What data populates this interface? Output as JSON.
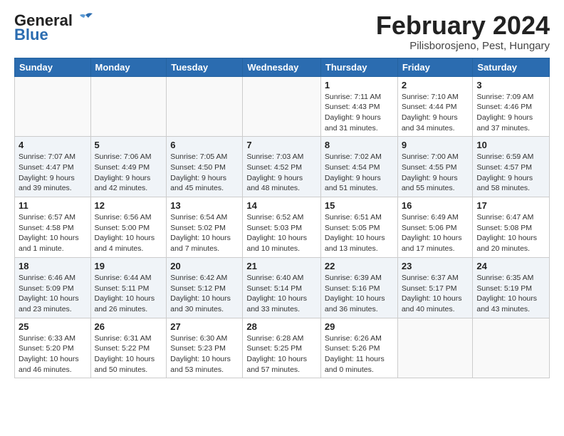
{
  "header": {
    "logo_general": "General",
    "logo_blue": "Blue",
    "month_title": "February 2024",
    "location": "Pilisborosjeno, Pest, Hungary"
  },
  "days_of_week": [
    "Sunday",
    "Monday",
    "Tuesday",
    "Wednesday",
    "Thursday",
    "Friday",
    "Saturday"
  ],
  "weeks": [
    [
      {
        "day": "",
        "info": ""
      },
      {
        "day": "",
        "info": ""
      },
      {
        "day": "",
        "info": ""
      },
      {
        "day": "",
        "info": ""
      },
      {
        "day": "1",
        "info": "Sunrise: 7:11 AM\nSunset: 4:43 PM\nDaylight: 9 hours\nand 31 minutes."
      },
      {
        "day": "2",
        "info": "Sunrise: 7:10 AM\nSunset: 4:44 PM\nDaylight: 9 hours\nand 34 minutes."
      },
      {
        "day": "3",
        "info": "Sunrise: 7:09 AM\nSunset: 4:46 PM\nDaylight: 9 hours\nand 37 minutes."
      }
    ],
    [
      {
        "day": "4",
        "info": "Sunrise: 7:07 AM\nSunset: 4:47 PM\nDaylight: 9 hours\nand 39 minutes."
      },
      {
        "day": "5",
        "info": "Sunrise: 7:06 AM\nSunset: 4:49 PM\nDaylight: 9 hours\nand 42 minutes."
      },
      {
        "day": "6",
        "info": "Sunrise: 7:05 AM\nSunset: 4:50 PM\nDaylight: 9 hours\nand 45 minutes."
      },
      {
        "day": "7",
        "info": "Sunrise: 7:03 AM\nSunset: 4:52 PM\nDaylight: 9 hours\nand 48 minutes."
      },
      {
        "day": "8",
        "info": "Sunrise: 7:02 AM\nSunset: 4:54 PM\nDaylight: 9 hours\nand 51 minutes."
      },
      {
        "day": "9",
        "info": "Sunrise: 7:00 AM\nSunset: 4:55 PM\nDaylight: 9 hours\nand 55 minutes."
      },
      {
        "day": "10",
        "info": "Sunrise: 6:59 AM\nSunset: 4:57 PM\nDaylight: 9 hours\nand 58 minutes."
      }
    ],
    [
      {
        "day": "11",
        "info": "Sunrise: 6:57 AM\nSunset: 4:58 PM\nDaylight: 10 hours\nand 1 minute."
      },
      {
        "day": "12",
        "info": "Sunrise: 6:56 AM\nSunset: 5:00 PM\nDaylight: 10 hours\nand 4 minutes."
      },
      {
        "day": "13",
        "info": "Sunrise: 6:54 AM\nSunset: 5:02 PM\nDaylight: 10 hours\nand 7 minutes."
      },
      {
        "day": "14",
        "info": "Sunrise: 6:52 AM\nSunset: 5:03 PM\nDaylight: 10 hours\nand 10 minutes."
      },
      {
        "day": "15",
        "info": "Sunrise: 6:51 AM\nSunset: 5:05 PM\nDaylight: 10 hours\nand 13 minutes."
      },
      {
        "day": "16",
        "info": "Sunrise: 6:49 AM\nSunset: 5:06 PM\nDaylight: 10 hours\nand 17 minutes."
      },
      {
        "day": "17",
        "info": "Sunrise: 6:47 AM\nSunset: 5:08 PM\nDaylight: 10 hours\nand 20 minutes."
      }
    ],
    [
      {
        "day": "18",
        "info": "Sunrise: 6:46 AM\nSunset: 5:09 PM\nDaylight: 10 hours\nand 23 minutes."
      },
      {
        "day": "19",
        "info": "Sunrise: 6:44 AM\nSunset: 5:11 PM\nDaylight: 10 hours\nand 26 minutes."
      },
      {
        "day": "20",
        "info": "Sunrise: 6:42 AM\nSunset: 5:12 PM\nDaylight: 10 hours\nand 30 minutes."
      },
      {
        "day": "21",
        "info": "Sunrise: 6:40 AM\nSunset: 5:14 PM\nDaylight: 10 hours\nand 33 minutes."
      },
      {
        "day": "22",
        "info": "Sunrise: 6:39 AM\nSunset: 5:16 PM\nDaylight: 10 hours\nand 36 minutes."
      },
      {
        "day": "23",
        "info": "Sunrise: 6:37 AM\nSunset: 5:17 PM\nDaylight: 10 hours\nand 40 minutes."
      },
      {
        "day": "24",
        "info": "Sunrise: 6:35 AM\nSunset: 5:19 PM\nDaylight: 10 hours\nand 43 minutes."
      }
    ],
    [
      {
        "day": "25",
        "info": "Sunrise: 6:33 AM\nSunset: 5:20 PM\nDaylight: 10 hours\nand 46 minutes."
      },
      {
        "day": "26",
        "info": "Sunrise: 6:31 AM\nSunset: 5:22 PM\nDaylight: 10 hours\nand 50 minutes."
      },
      {
        "day": "27",
        "info": "Sunrise: 6:30 AM\nSunset: 5:23 PM\nDaylight: 10 hours\nand 53 minutes."
      },
      {
        "day": "28",
        "info": "Sunrise: 6:28 AM\nSunset: 5:25 PM\nDaylight: 10 hours\nand 57 minutes."
      },
      {
        "day": "29",
        "info": "Sunrise: 6:26 AM\nSunset: 5:26 PM\nDaylight: 11 hours\nand 0 minutes."
      },
      {
        "day": "",
        "info": ""
      },
      {
        "day": "",
        "info": ""
      }
    ]
  ]
}
